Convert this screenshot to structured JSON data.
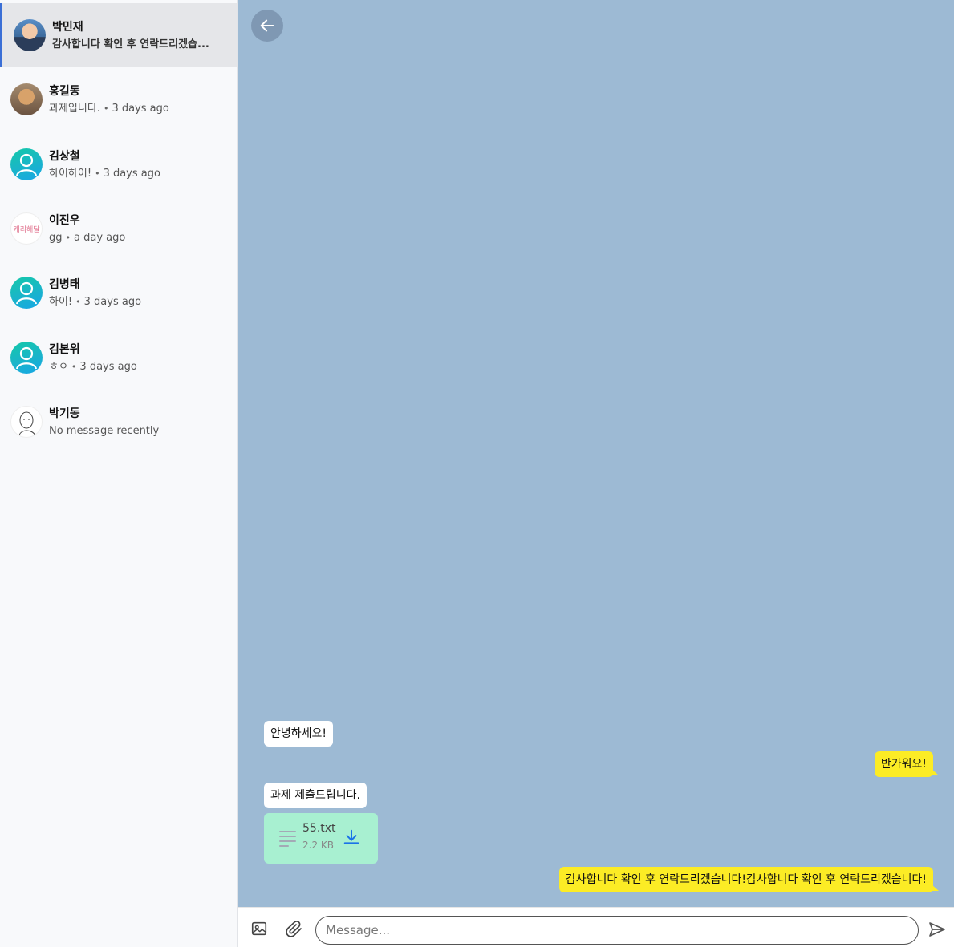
{
  "conversations": [
    {
      "name": "박민재",
      "preview": "감사합니다 확인 후 연락드리겠습...",
      "time": "",
      "avatar": "photo-man-suit",
      "active": true
    },
    {
      "name": "홍길동",
      "preview": "과제입니다.",
      "time": "3 days ago",
      "avatar": "photo-face"
    },
    {
      "name": "김상철",
      "preview": "하이하이!",
      "time": "3 days ago",
      "avatar": "default-user-icon"
    },
    {
      "name": "이진우",
      "preview": "gg",
      "time": "a day ago",
      "avatar": "text-logo"
    },
    {
      "name": "김병태",
      "preview": "하이!",
      "time": "3 days ago",
      "avatar": "default-user-icon"
    },
    {
      "name": "김본위",
      "preview": "ㅎㅇ",
      "time": "3 days ago",
      "avatar": "default-user-icon"
    },
    {
      "name": "박기동",
      "preview": "No message recently",
      "time": "",
      "avatar": "sketch-drawing"
    }
  ],
  "avatar_logo_text": "캐리해달",
  "messages": [
    {
      "direction": "in",
      "text": "안녕하세요!"
    },
    {
      "direction": "out",
      "text": "반가워요!"
    },
    {
      "direction": "in",
      "text": "과제 제출드립니다."
    },
    {
      "direction": "in",
      "type": "file",
      "file_name": "55.txt",
      "file_size": "2.2 KB"
    },
    {
      "direction": "out",
      "text": "감사합니다 확인 후 연락드리겠습니다!감사합니다 확인 후 연락드리겠습니다!"
    }
  ],
  "composer": {
    "placeholder": "Message...",
    "value": ""
  },
  "colors": {
    "chat_background": "#9dbad4",
    "incoming_bubble": "#ffffff",
    "outgoing_bubble": "#fcec25",
    "file_card": "#a8f0d1",
    "active_accent": "#3b6fd6",
    "download_icon": "#1a73e8"
  },
  "icons": {
    "back": "arrow-left-icon",
    "image": "image-icon",
    "attach": "paperclip-icon",
    "send": "send-icon",
    "file": "file-lines-icon",
    "download": "download-icon"
  }
}
